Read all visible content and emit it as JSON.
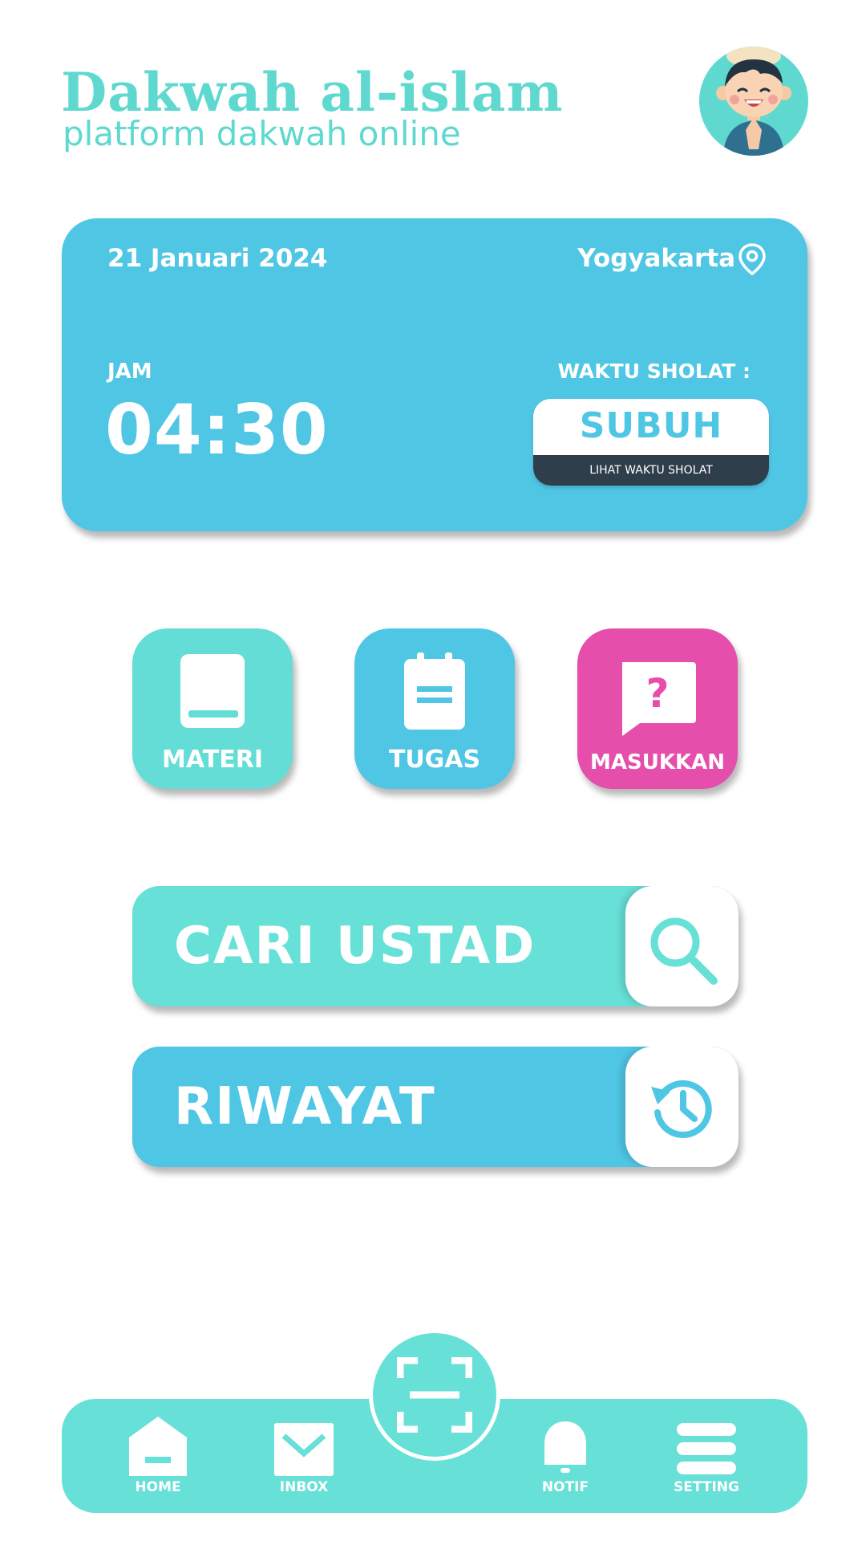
{
  "header": {
    "title": "Dakwah al-islam",
    "subtitle": "platform dakwah online"
  },
  "prayer_card": {
    "date": "21 Januari 2024",
    "location": "Yogyakarta",
    "clock_label": "JAM",
    "clock_time": "04:30",
    "prayer_label": "WAKTU SHOLAT :",
    "prayer_name": "SUBUH",
    "see_times_label": "LIHAT WAKTU SHOLAT"
  },
  "menu": {
    "materi": "MATERI",
    "tugas": "TUGAS",
    "masukkan": "MASUKKAN"
  },
  "actions": {
    "cari_ustad": "CARI USTAD",
    "riwayat": "RIWAYAT"
  },
  "bottom_nav": {
    "home": "HOME",
    "inbox": "INBOX",
    "notif": "NOTIF",
    "setting": "SETTING"
  },
  "colors": {
    "teal": "#67e0d7",
    "sky_blue": "#50c6e5",
    "pink": "#e54fab",
    "dark": "#2f3e4b"
  },
  "icons": [
    "location-pin-icon",
    "book-icon",
    "clipboard-icon",
    "question-chat-icon",
    "search-icon",
    "history-icon",
    "home-icon",
    "inbox-icon",
    "scan-icon",
    "bell-icon",
    "menu-icon"
  ]
}
